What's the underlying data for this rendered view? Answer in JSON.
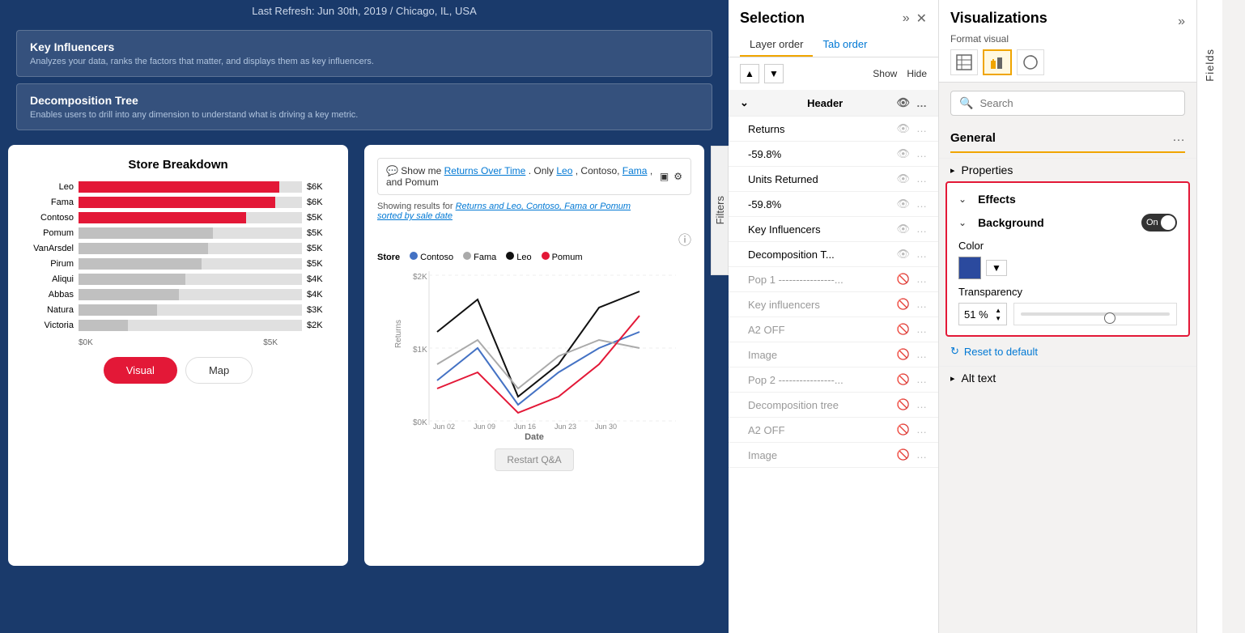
{
  "topbar": {
    "last_refresh": "Last Refresh: Jun 30th, 2019 / Chicago, IL, USA"
  },
  "visual_chooser": {
    "key_influencers": {
      "title": "Key Influencers",
      "description": "Analyzes your data, ranks the factors that matter, and displays them as key influencers."
    },
    "decomposition_tree": {
      "title": "Decomposition Tree",
      "description": "Enables users to drill into any dimension to understand what is driving a key metric."
    }
  },
  "store_breakdown": {
    "title": "Store Breakdown",
    "bars": [
      {
        "label": "Leo",
        "value": "$6K",
        "pct": 90,
        "red": true
      },
      {
        "label": "Fama",
        "value": "$6K",
        "pct": 88,
        "red": true
      },
      {
        "label": "Contoso",
        "value": "$5K",
        "pct": 75,
        "red": true
      },
      {
        "label": "Pomum",
        "value": "$5K",
        "pct": 60,
        "red": false
      },
      {
        "label": "VanArsdel",
        "value": "$5K",
        "pct": 58,
        "red": false
      },
      {
        "label": "Pirum",
        "value": "$5K",
        "pct": 55,
        "red": false
      },
      {
        "label": "Aliqui",
        "value": "$4K",
        "pct": 48,
        "red": false
      },
      {
        "label": "Abbas",
        "value": "$4K",
        "pct": 45,
        "red": false
      },
      {
        "label": "Natura",
        "value": "$3K",
        "pct": 35,
        "red": false
      },
      {
        "label": "Victoria",
        "value": "$2K",
        "pct": 22,
        "red": false
      }
    ],
    "x_axis": [
      "$0K",
      "$5K"
    ],
    "tabs": [
      {
        "label": "Visual",
        "active": true
      },
      {
        "label": "Map",
        "active": false
      }
    ]
  },
  "qa_chart": {
    "input_text": "Show me Returns Over Time. Only Leo, Contoso, Fama, and Pomum",
    "showing_label": "Showing results for",
    "showing_link": "Returns and Leo, Contoso, Fama or Pomum",
    "sorted_label": "sorted by sale date",
    "store_label": "Store",
    "legend": [
      {
        "name": "Contoso",
        "color": "#4472c4"
      },
      {
        "name": "Fama",
        "color": "#aaa"
      },
      {
        "name": "Leo",
        "color": "#111"
      },
      {
        "name": "Pomum",
        "color": "#e31837"
      }
    ],
    "y_axis": [
      "$2K",
      "$1K",
      "$0K"
    ],
    "x_axis": [
      "Jun 02",
      "Jun 09",
      "Jun 16",
      "Jun 23",
      "Jun 30"
    ],
    "x_label": "Date",
    "y_label": "Returns",
    "restart_btn": "Restart Q&A"
  },
  "selection": {
    "title": "Selection",
    "tabs": [
      {
        "label": "Layer order",
        "active": true
      },
      {
        "label": "Tab order",
        "active": false
      }
    ],
    "show_label": "Show",
    "hide_label": "Hide",
    "group_header": "Header",
    "items": [
      {
        "label": "Returns",
        "dashed": false,
        "visible": true
      },
      {
        "label": "-59.8%",
        "dashed": false,
        "visible": true
      },
      {
        "label": "Units Returned",
        "dashed": false,
        "visible": true
      },
      {
        "label": "-59.8%",
        "dashed": false,
        "visible": true
      },
      {
        "label": "Key Influencers",
        "dashed": false,
        "visible": true
      },
      {
        "label": "Decomposition T...",
        "dashed": false,
        "visible": true
      },
      {
        "label": "Pop 1 ----------------...",
        "dashed": true,
        "visible": false
      },
      {
        "label": "Key influencers",
        "dashed": false,
        "visible": false
      },
      {
        "label": "A2 OFF",
        "dashed": false,
        "visible": false
      },
      {
        "label": "Image",
        "dashed": false,
        "visible": false
      },
      {
        "label": "Pop 2 ----------------...",
        "dashed": true,
        "visible": false
      },
      {
        "label": "Decomposition tree",
        "dashed": false,
        "visible": false
      },
      {
        "label": "A2 OFF",
        "dashed": false,
        "visible": false
      },
      {
        "label": "Image",
        "dashed": false,
        "visible": false
      }
    ],
    "filters_label": "Filters"
  },
  "visualizations": {
    "title": "Visualizations",
    "format_visual": "Format visual",
    "search_placeholder": "Search",
    "general_label": "General",
    "three_dots": "...",
    "properties_label": "Properties",
    "effects_label": "Effects",
    "background_label": "Background",
    "toggle_state": "On",
    "color_label": "Color",
    "transparency_label": "Transparency",
    "transparency_value": "51 %",
    "reset_label": "Reset to default",
    "alt_text_label": "Alt text",
    "fields_label": "Fields"
  }
}
